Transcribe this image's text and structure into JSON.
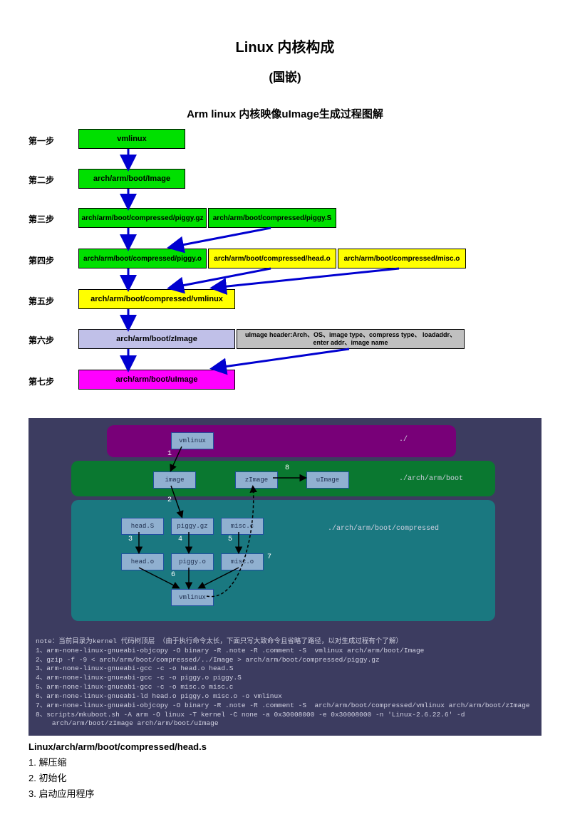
{
  "title": "Linux 内核构成",
  "subtitle": "(国嵌)",
  "diagram1": {
    "title": "Arm linux 内核映像uImage生成过程图解",
    "steps": {
      "s1": "第一步",
      "s2": "第二步",
      "s3": "第三步",
      "s4": "第四步",
      "s5": "第五步",
      "s6": "第六步",
      "s7": "第七步"
    },
    "boxes": {
      "b1": "vmlinux",
      "b2": "arch/arm/boot/Image",
      "b3a": "arch/arm/boot/compressed/piggy.gz",
      "b3b": "arch/arm/boot/compressed/piggy.S",
      "b4a": "arch/arm/boot/compressed/piggy.o",
      "b4b": "arch/arm/boot/compressed/head.o",
      "b4c": "arch/arm/boot/compressed/misc.o",
      "b5": "arch/arm/boot/compressed/vmlinux",
      "b6": "arch/arm/boot/zImage",
      "b6h": "uImage header:Arch、OS、image type、compress type、 loadaddr、enter addr、image name",
      "b7": "arch/arm/boot/uImage"
    }
  },
  "diagram2": {
    "labels": {
      "root": "./",
      "archboot": "./arch/arm/boot",
      "compressed": "./arch/arm/boot/compressed"
    },
    "nodes": {
      "vmlinux": "vmlinux",
      "image": "image",
      "zimage": "zImage",
      "uimage": "uImage",
      "heads": "head.S",
      "piggygz": "piggy.gz",
      "miscc": "misc.c",
      "heado": "head.o",
      "piggyo": "piggy.o",
      "misco": "misc.o",
      "vmlinux2": "vmlinux"
    },
    "edges": {
      "e1": "1",
      "e2": "2",
      "e3": "3",
      "e4": "4",
      "e5": "5",
      "e6": "6",
      "e7": "7",
      "e8": "8"
    },
    "terminal": "note：当前目录为kernel 代码树顶层 （由于执行命令太长，下面只写大致命令且省略了路径，以对生成过程有个了解）\n1、arm-none-linux-gnueabi-objcopy -O binary -R .note -R .comment -S  vmlinux arch/arm/boot/Image\n2、gzip -f -9 < arch/arm/boot/compressed/../Image > arch/arm/boot/compressed/piggy.gz\n3、arm-none-linux-gnueabi-gcc -c -o head.o head.S\n4、arm-none-linux-gnueabi-gcc -c -o piggy.o piggy.S\n5、arm-none-linux-gnueabi-gcc -c -o misc.o misc.c\n6、arm-none-linux-gnueabi-ld head.o piggy.o misc.o -o vmlinux\n7、arm-none-linux-gnueabi-objcopy -O binary -R .note -R .comment -S  arch/arm/boot/compressed/vmlinux arch/arm/boot/zImage\n8、scripts/mkuboot.sh -A arm -O linux -T kernel -C none -a 0x30008000 -e 0x30008000 -n 'Linux-2.6.22.6' -d\n    arch/arm/boot/zImage arch/arm/boot/uImage"
  },
  "body": {
    "head": "Linux/arch/arm/boot/compressed/head.s",
    "l1": "1.  解压缩",
    "l2": "2.  初始化",
    "l3": "3.  启动应用程序"
  }
}
